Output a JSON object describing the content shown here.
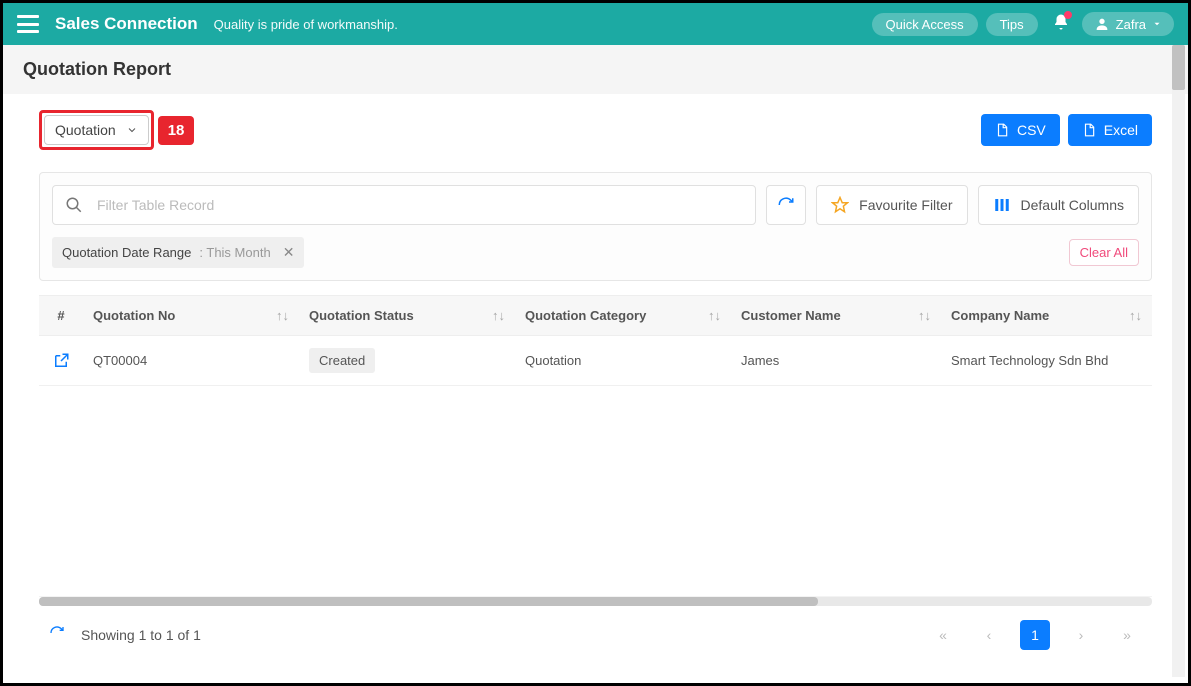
{
  "header": {
    "brand": "Sales Connection",
    "tagline": "Quality is pride of workmanship.",
    "quick_access": "Quick Access",
    "tips": "Tips",
    "user_name": "Zafra"
  },
  "page": {
    "title": "Quotation Report"
  },
  "toolbar": {
    "dropdown_label": "Quotation",
    "callout_number": "18",
    "csv_label": "CSV",
    "excel_label": "Excel"
  },
  "filter": {
    "search_placeholder": "Filter Table Record",
    "favourite_label": "Favourite Filter",
    "default_columns_label": "Default Columns",
    "chip_label": "Quotation Date Range",
    "chip_value": "This Month",
    "clear_all": "Clear All"
  },
  "table": {
    "columns": {
      "hash": "#",
      "quotation_no": "Quotation No",
      "status": "Quotation Status",
      "category": "Quotation Category",
      "customer": "Customer Name",
      "company": "Company Name"
    },
    "rows": [
      {
        "quotation_no": "QT00004",
        "status": "Created",
        "category": "Quotation",
        "customer": "James",
        "company": "Smart Technology Sdn Bhd"
      }
    ]
  },
  "pagination": {
    "info": "Showing 1 to 1 of 1",
    "current_page": "1"
  }
}
